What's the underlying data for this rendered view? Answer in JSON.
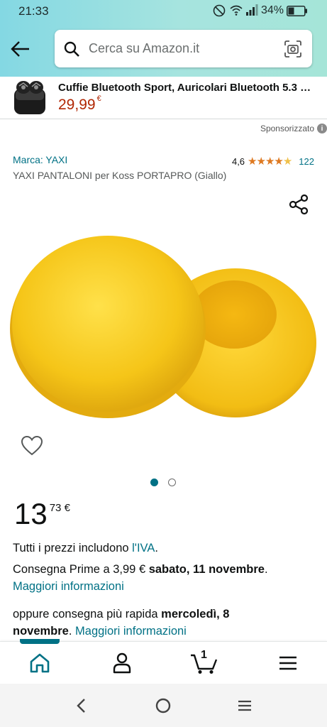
{
  "status_bar": {
    "time": "21:33",
    "battery": "34%",
    "icons": [
      "do-not-disturb-icon",
      "wifi-icon",
      "signal-icon",
      "battery-icon"
    ]
  },
  "search": {
    "placeholder": "Cerca su Amazon.it"
  },
  "sponsored_banner": {
    "title": "Cuffie Bluetooth Sport, Auricolari Bluetooth 5.3 Cuffie Wireless",
    "price_int": "29,99",
    "currency": "€",
    "label": "Sponsorizzato"
  },
  "product": {
    "brand": "Marca: YAXI",
    "rating_value": "4,6",
    "rating_stars": 4.5,
    "rating_count": "122",
    "title": "YAXI PANTALONI per Koss PORTAPRO (Giallo)",
    "image_count": 2,
    "active_image": 1,
    "price_int": "13",
    "price_frac": "73 €"
  },
  "details": {
    "vat_prefix": "Tutti i prezzi includono ",
    "vat_link": "l'IVA",
    "vat_suffix": ".",
    "delivery_prefix": "Consegna Prime a 3,99 € ",
    "delivery_date": "sabato, 11 novembre",
    "delivery_suffix": ".",
    "more_info": "Maggiori informazioni",
    "fast_prefix": "oppure consegna più rapida ",
    "fast_date_1": "mercoledì, 8",
    "fast_date_2": "novembre",
    "fast_suffix": ". ",
    "fast_more_info": "Maggiori informazioni"
  },
  "tabbar": {
    "cart_count": "1",
    "items": [
      "home-icon",
      "account-icon",
      "cart-icon",
      "menu-icon"
    ]
  },
  "colors": {
    "header_gradient_start": "#84d8e3",
    "header_gradient_end": "#a5e5d8",
    "link": "#007185",
    "price_red": "#b12704",
    "star": "#de7921",
    "product_yellow": "#f5c518"
  }
}
